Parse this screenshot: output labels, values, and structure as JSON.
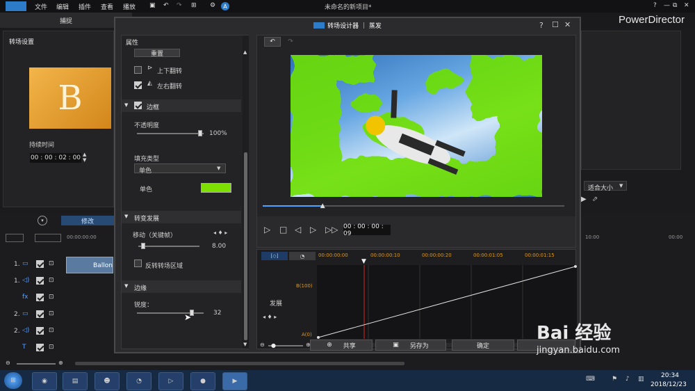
{
  "app": {
    "menu": [
      "文件",
      "编辑",
      "插件",
      "查看",
      "播放"
    ],
    "project_title": "未命名的新项目*",
    "brand": "PowerDirector",
    "win_controls": [
      "?",
      "—",
      "⧉",
      "✕"
    ]
  },
  "main": {
    "tab_capture": "捕捉",
    "panel_title": "转场设置",
    "thumb_letter": "B",
    "duration_label": "持续时间",
    "duration_value": "00 : 00 : 02 : 00",
    "modify_btn": "修改",
    "fit_label": "适合大小",
    "timecode_left": "00:00:00:00",
    "ruler_right": [
      "10:00",
      "00:00"
    ],
    "clip_label": "Ballon"
  },
  "tracks": [
    {
      "num": "1.",
      "kind": "video"
    },
    {
      "num": "1.",
      "kind": "audio"
    },
    {
      "num": "",
      "kind": "fx"
    },
    {
      "num": "2.",
      "kind": "video"
    },
    {
      "num": "2.",
      "kind": "audio"
    },
    {
      "num": "",
      "kind": "text"
    }
  ],
  "dialog": {
    "title": "转场设计器 ｜ 蒸发",
    "help": "?",
    "max": "☐",
    "close": "✕",
    "props_header": "属性",
    "reset_btn": "重置",
    "flip_v": "上下翻转",
    "flip_h": "左右翻转",
    "border_section": "边框",
    "opacity_label": "不透明度",
    "opacity_value": "100%",
    "opacity_level": 0.95,
    "fill_type_label": "填充类型",
    "fill_type_value": "单色",
    "fill_color_label": "单色",
    "fill_color": "#7ee000",
    "progress_section": "转变发展",
    "move_label": "移动（关键帧）",
    "move_value": "8.00",
    "move_level": 0.08,
    "reverse_label": "反转转场区域",
    "edge_section": "边缘",
    "sharp_label": "锐度：",
    "sharp_value": "32",
    "sharp_level": 0.82,
    "timecode": "00 : 00 : 00 : 09",
    "scrub_level": 0.2,
    "tl_tab1": "[◇]",
    "tl_tab2": "◔",
    "tl_times": [
      "00:00:00:00",
      "00:00:00:10",
      "00:00:00:20",
      "00:00:01:05",
      "00:00:01:15"
    ],
    "tl_y_top": "B(100)",
    "tl_y_bottom": "A(0)",
    "tl_track": "发展",
    "btn_share": "共享",
    "btn_saveas": "另存为",
    "btn_ok": "确定"
  },
  "taskbar": {
    "time": "20:34",
    "date": "2018/12/23"
  },
  "watermark": {
    "text": "Bai 经验",
    "url": "jingyan.baidu.com"
  }
}
